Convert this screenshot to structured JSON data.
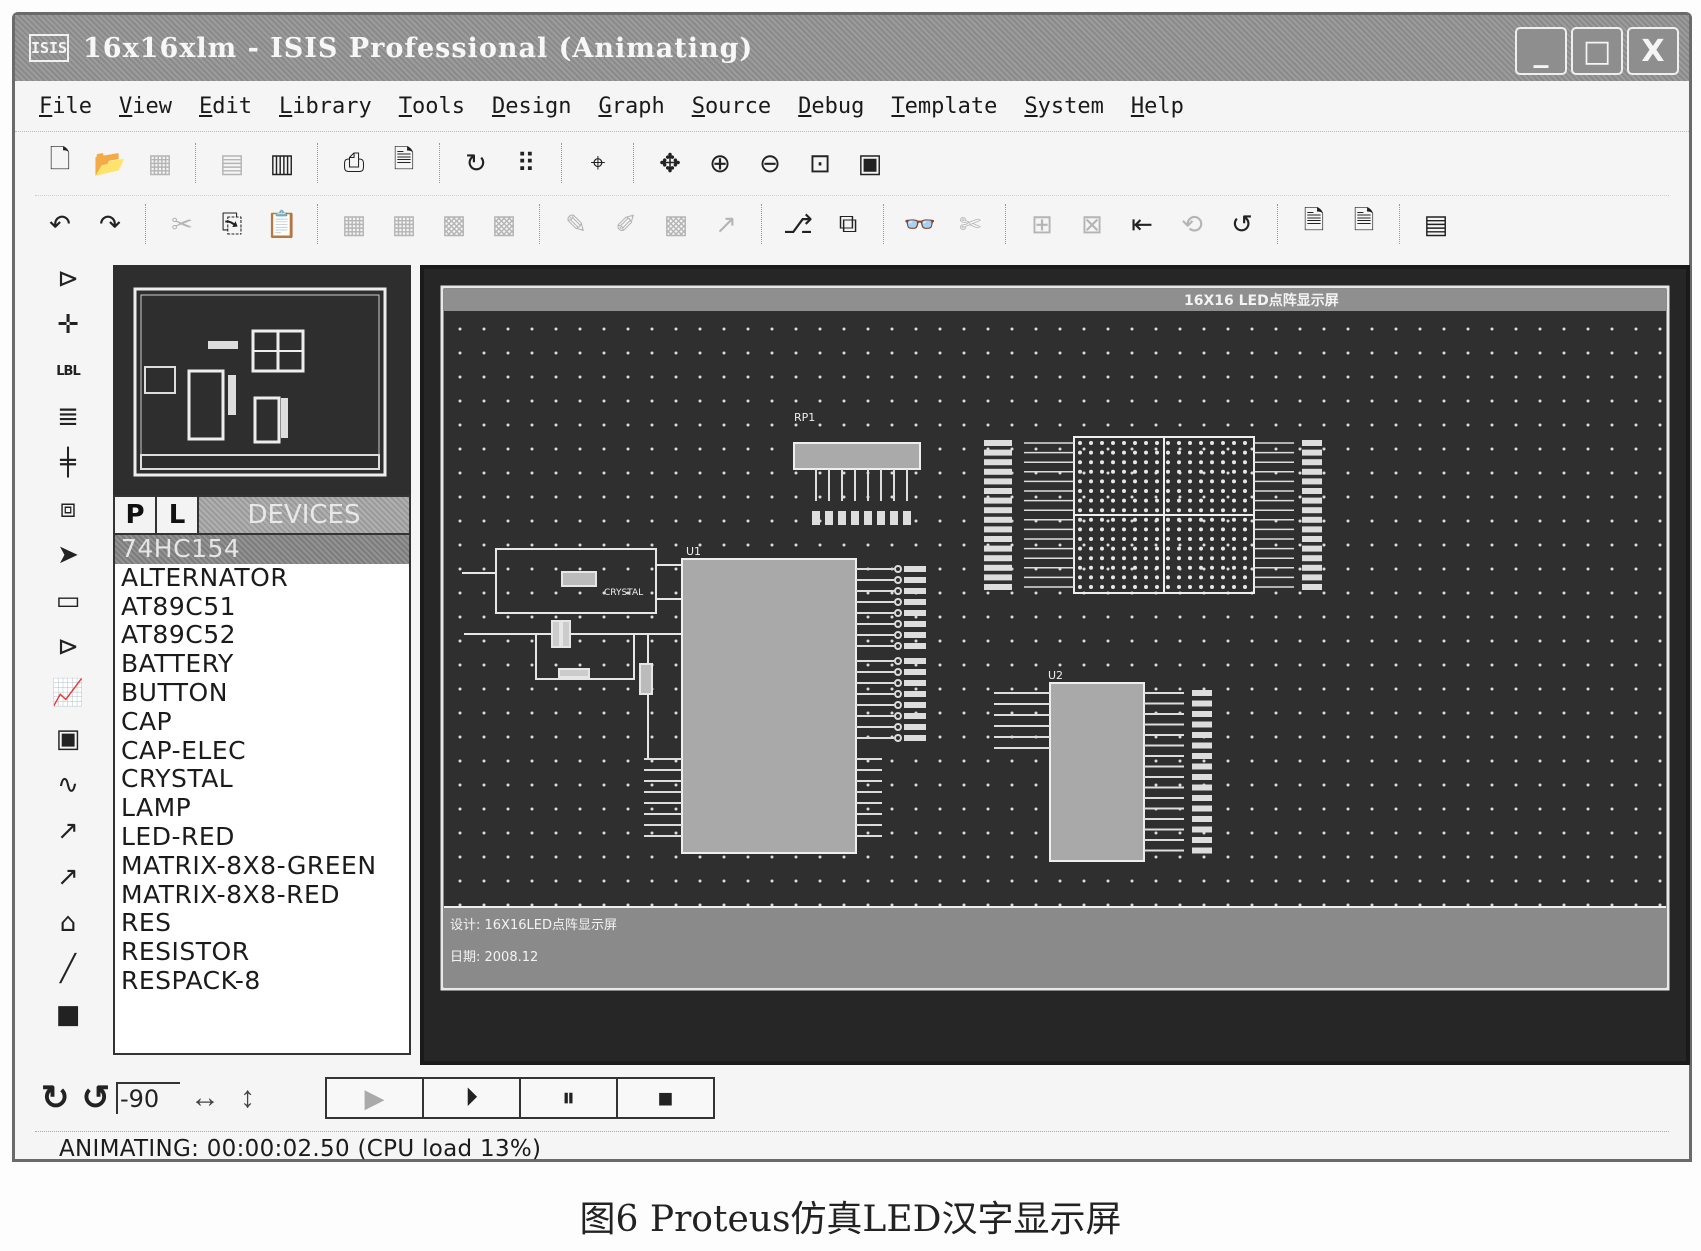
{
  "window": {
    "logo": "ISIS",
    "title": "16x16xlm - ISIS Professional (Animating)",
    "buttons": {
      "minimize": "_",
      "maximize": "□",
      "close": "X"
    }
  },
  "menu": [
    "File",
    "View",
    "Edit",
    "Library",
    "Tools",
    "Design",
    "Graph",
    "Source",
    "Debug",
    "Template",
    "System",
    "Help"
  ],
  "toolbar1": [
    {
      "name": "new-file-icon",
      "glyph": "🗋",
      "enabled": true
    },
    {
      "name": "open-file-icon",
      "glyph": "📂",
      "enabled": true
    },
    {
      "name": "save-file-icon",
      "glyph": "▦",
      "enabled": false
    },
    {
      "name": "import-section-icon",
      "glyph": "▤",
      "enabled": false
    },
    {
      "name": "export-section-icon",
      "glyph": "▥",
      "enabled": true
    },
    {
      "name": "print-icon",
      "glyph": "⎙",
      "enabled": true
    },
    {
      "name": "set-area-icon",
      "glyph": "🗎",
      "enabled": true
    },
    {
      "name": "redraw-icon",
      "glyph": "↻",
      "enabled": true
    },
    {
      "name": "grid-icon",
      "glyph": "⠿",
      "enabled": true
    },
    {
      "name": "origin-icon",
      "glyph": "⌖",
      "enabled": true
    },
    {
      "name": "pan-icon",
      "glyph": "✥",
      "enabled": true
    },
    {
      "name": "zoom-in-icon",
      "glyph": "⊕",
      "enabled": true
    },
    {
      "name": "zoom-out-icon",
      "glyph": "⊖",
      "enabled": true
    },
    {
      "name": "zoom-all-icon",
      "glyph": "⊡",
      "enabled": true
    },
    {
      "name": "zoom-area-icon",
      "glyph": "▣",
      "enabled": true
    }
  ],
  "toolbar2": [
    {
      "name": "undo-icon",
      "glyph": "↶",
      "enabled": true
    },
    {
      "name": "redo-icon",
      "glyph": "↷",
      "enabled": true
    },
    {
      "name": "cut-icon",
      "glyph": "✂",
      "enabled": false
    },
    {
      "name": "copy-icon",
      "glyph": "⎘",
      "enabled": true
    },
    {
      "name": "paste-icon",
      "glyph": "📋",
      "enabled": false
    },
    {
      "name": "block-copy-icon",
      "glyph": "▦",
      "enabled": false
    },
    {
      "name": "block-move-icon",
      "glyph": "▦",
      "enabled": false
    },
    {
      "name": "block-rotate-icon",
      "glyph": "▩",
      "enabled": false
    },
    {
      "name": "block-delete-icon",
      "glyph": "▩",
      "enabled": false
    },
    {
      "name": "pick-device-icon",
      "glyph": "✎",
      "enabled": false
    },
    {
      "name": "make-device-icon",
      "glyph": "✐",
      "enabled": false
    },
    {
      "name": "packaging-tool-icon",
      "glyph": "▩",
      "enabled": false
    },
    {
      "name": "decompose-icon",
      "glyph": "↗",
      "enabled": false
    },
    {
      "name": "wire-autorouter-icon",
      "glyph": "⎇",
      "enabled": true
    },
    {
      "name": "property-assignment-icon",
      "glyph": "⧉",
      "enabled": true
    },
    {
      "name": "search-tag-icon",
      "glyph": "👓",
      "enabled": true
    },
    {
      "name": "search-component-icon",
      "glyph": "✄",
      "enabled": false
    },
    {
      "name": "new-sheet-icon",
      "glyph": "⊞",
      "enabled": false
    },
    {
      "name": "remove-sheet-icon",
      "glyph": "⊠",
      "enabled": false
    },
    {
      "name": "exit-to-parent-icon",
      "glyph": "⇤",
      "enabled": true
    },
    {
      "name": "netlist-transfer-icon",
      "glyph": "⟲",
      "enabled": false
    },
    {
      "name": "back-annotate-icon",
      "glyph": "↺",
      "enabled": true
    },
    {
      "name": "bill-of-materials-icon",
      "glyph": "🗎",
      "enabled": true
    },
    {
      "name": "electrical-rule-check-icon",
      "glyph": "🗎",
      "enabled": true
    },
    {
      "name": "netlist-to-ares-icon",
      "glyph": "▤",
      "enabled": true
    }
  ],
  "left_toolbar": [
    {
      "name": "component-mode-icon",
      "glyph": "⊳"
    },
    {
      "name": "junction-dot-icon",
      "glyph": "✛"
    },
    {
      "name": "wire-label-icon",
      "glyph": "LBL",
      "small": true
    },
    {
      "name": "text-script-icon",
      "glyph": "≣"
    },
    {
      "name": "bus-icon",
      "glyph": "╪"
    },
    {
      "name": "subcircuit-icon",
      "glyph": "⧈"
    },
    {
      "name": "selection-mode-icon",
      "glyph": "➤"
    },
    {
      "name": "terminals-mode-icon",
      "glyph": "▭"
    },
    {
      "name": "device-pins-icon",
      "glyph": "⊳"
    },
    {
      "name": "graph-mode-icon",
      "glyph": "📈"
    },
    {
      "name": "tape-recorder-icon",
      "glyph": "▣"
    },
    {
      "name": "generator-mode-icon",
      "glyph": "∿"
    },
    {
      "name": "voltage-probe-icon",
      "glyph": "↗"
    },
    {
      "name": "current-probe-icon",
      "glyph": "↗"
    },
    {
      "name": "virtual-instruments-icon",
      "glyph": "⌂"
    },
    {
      "name": "2d-line-icon",
      "glyph": "╱"
    },
    {
      "name": "2d-box-icon",
      "glyph": "■"
    }
  ],
  "devices_panel": {
    "tab_p": "P",
    "tab_l": "L",
    "title": "DEVICES",
    "selected_index": 0,
    "items": [
      "74HC154",
      "ALTERNATOR",
      "AT89C51",
      "AT89C52",
      "BATTERY",
      "BUTTON",
      "CAP",
      "CAP-ELEC",
      "CRYSTAL",
      "LAMP",
      "LED-RED",
      "MATRIX-8X8-GREEN",
      "MATRIX-8X8-RED",
      "RES",
      "RESISTOR",
      "RESPACK-8"
    ]
  },
  "schematic": {
    "sheet_title": "16X16 LED点阵显示屏",
    "crystal_label": "CRYSTAL",
    "mcu_ref": "U1",
    "decoder_ref": "U2",
    "respack_ref": "RP1",
    "footer_line1": "设计: 16X16LED点阵显示屏",
    "footer_line2": "日期: 2008.12"
  },
  "bottom": {
    "rotation_value": "-90",
    "sim_buttons": [
      {
        "name": "play-button",
        "glyph": "▶",
        "enabled": false
      },
      {
        "name": "step-button",
        "glyph": "⏵",
        "enabled": true
      },
      {
        "name": "pause-button",
        "glyph": "⏸",
        "enabled": true
      },
      {
        "name": "stop-button",
        "glyph": "■",
        "enabled": true
      }
    ]
  },
  "status": {
    "text": "ANIMATING: 00:00:02.50 (CPU load 13%)"
  },
  "caption": "图6  Proteus仿真LED汉字显示屏"
}
